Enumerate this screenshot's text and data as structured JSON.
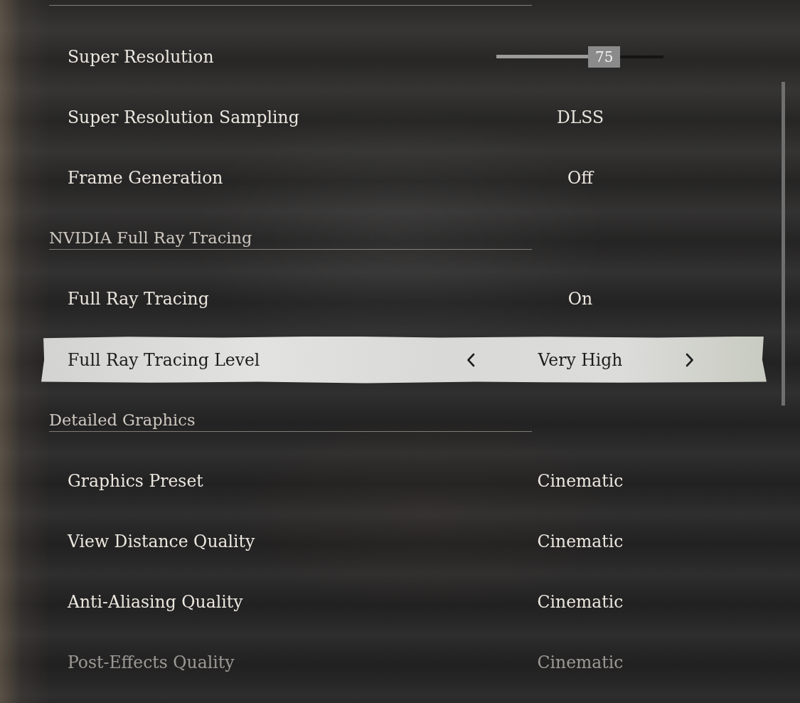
{
  "rows": [
    {
      "kind": "slider",
      "label": "Super Resolution",
      "value": "75",
      "level": 0.55,
      "selected": false
    },
    {
      "kind": "option",
      "label": "Super Resolution Sampling",
      "value": "DLSS",
      "selected": false
    },
    {
      "kind": "option",
      "label": "Frame Generation",
      "value": "Off",
      "selected": false
    },
    {
      "kind": "header",
      "label": "NVIDIA Full Ray Tracing"
    },
    {
      "kind": "option",
      "label": "Full Ray Tracing",
      "value": "On",
      "selected": false
    },
    {
      "kind": "option",
      "label": "Full Ray Tracing Level",
      "value": "Very High",
      "selected": true
    },
    {
      "kind": "header",
      "label": "Detailed Graphics"
    },
    {
      "kind": "option",
      "label": "Graphics Preset",
      "value": "Cinematic",
      "selected": false
    },
    {
      "kind": "option",
      "label": "View Distance Quality",
      "value": "Cinematic",
      "selected": false
    },
    {
      "kind": "option",
      "label": "Anti-Aliasing Quality",
      "value": "Cinematic",
      "selected": false
    },
    {
      "kind": "option",
      "label": "Post-Effects Quality",
      "value": "Cinematic",
      "selected": false
    }
  ]
}
